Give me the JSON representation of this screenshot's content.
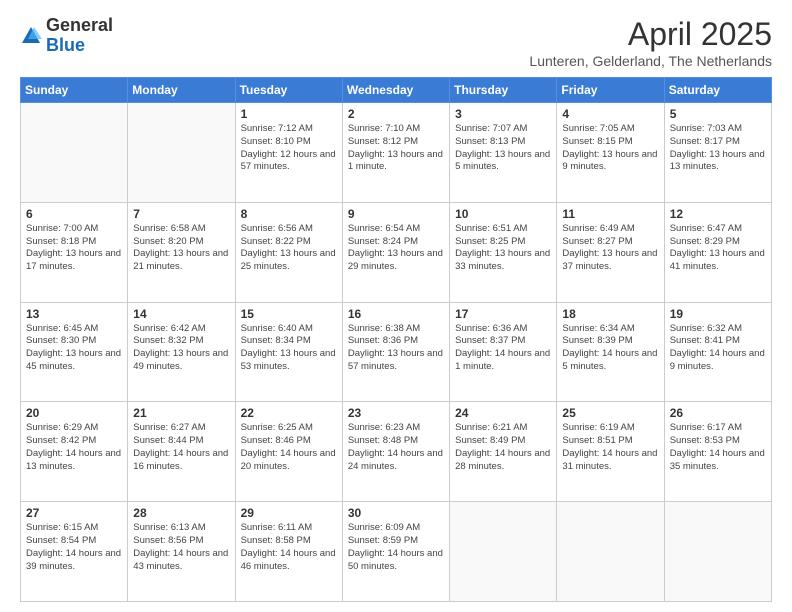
{
  "header": {
    "logo_general": "General",
    "logo_blue": "Blue",
    "month_title": "April 2025",
    "location": "Lunteren, Gelderland, The Netherlands"
  },
  "weekdays": [
    "Sunday",
    "Monday",
    "Tuesday",
    "Wednesday",
    "Thursday",
    "Friday",
    "Saturday"
  ],
  "weeks": [
    [
      {
        "day": "",
        "info": ""
      },
      {
        "day": "",
        "info": ""
      },
      {
        "day": "1",
        "info": "Sunrise: 7:12 AM\nSunset: 8:10 PM\nDaylight: 12 hours and 57 minutes."
      },
      {
        "day": "2",
        "info": "Sunrise: 7:10 AM\nSunset: 8:12 PM\nDaylight: 13 hours and 1 minute."
      },
      {
        "day": "3",
        "info": "Sunrise: 7:07 AM\nSunset: 8:13 PM\nDaylight: 13 hours and 5 minutes."
      },
      {
        "day": "4",
        "info": "Sunrise: 7:05 AM\nSunset: 8:15 PM\nDaylight: 13 hours and 9 minutes."
      },
      {
        "day": "5",
        "info": "Sunrise: 7:03 AM\nSunset: 8:17 PM\nDaylight: 13 hours and 13 minutes."
      }
    ],
    [
      {
        "day": "6",
        "info": "Sunrise: 7:00 AM\nSunset: 8:18 PM\nDaylight: 13 hours and 17 minutes."
      },
      {
        "day": "7",
        "info": "Sunrise: 6:58 AM\nSunset: 8:20 PM\nDaylight: 13 hours and 21 minutes."
      },
      {
        "day": "8",
        "info": "Sunrise: 6:56 AM\nSunset: 8:22 PM\nDaylight: 13 hours and 25 minutes."
      },
      {
        "day": "9",
        "info": "Sunrise: 6:54 AM\nSunset: 8:24 PM\nDaylight: 13 hours and 29 minutes."
      },
      {
        "day": "10",
        "info": "Sunrise: 6:51 AM\nSunset: 8:25 PM\nDaylight: 13 hours and 33 minutes."
      },
      {
        "day": "11",
        "info": "Sunrise: 6:49 AM\nSunset: 8:27 PM\nDaylight: 13 hours and 37 minutes."
      },
      {
        "day": "12",
        "info": "Sunrise: 6:47 AM\nSunset: 8:29 PM\nDaylight: 13 hours and 41 minutes."
      }
    ],
    [
      {
        "day": "13",
        "info": "Sunrise: 6:45 AM\nSunset: 8:30 PM\nDaylight: 13 hours and 45 minutes."
      },
      {
        "day": "14",
        "info": "Sunrise: 6:42 AM\nSunset: 8:32 PM\nDaylight: 13 hours and 49 minutes."
      },
      {
        "day": "15",
        "info": "Sunrise: 6:40 AM\nSunset: 8:34 PM\nDaylight: 13 hours and 53 minutes."
      },
      {
        "day": "16",
        "info": "Sunrise: 6:38 AM\nSunset: 8:36 PM\nDaylight: 13 hours and 57 minutes."
      },
      {
        "day": "17",
        "info": "Sunrise: 6:36 AM\nSunset: 8:37 PM\nDaylight: 14 hours and 1 minute."
      },
      {
        "day": "18",
        "info": "Sunrise: 6:34 AM\nSunset: 8:39 PM\nDaylight: 14 hours and 5 minutes."
      },
      {
        "day": "19",
        "info": "Sunrise: 6:32 AM\nSunset: 8:41 PM\nDaylight: 14 hours and 9 minutes."
      }
    ],
    [
      {
        "day": "20",
        "info": "Sunrise: 6:29 AM\nSunset: 8:42 PM\nDaylight: 14 hours and 13 minutes."
      },
      {
        "day": "21",
        "info": "Sunrise: 6:27 AM\nSunset: 8:44 PM\nDaylight: 14 hours and 16 minutes."
      },
      {
        "day": "22",
        "info": "Sunrise: 6:25 AM\nSunset: 8:46 PM\nDaylight: 14 hours and 20 minutes."
      },
      {
        "day": "23",
        "info": "Sunrise: 6:23 AM\nSunset: 8:48 PM\nDaylight: 14 hours and 24 minutes."
      },
      {
        "day": "24",
        "info": "Sunrise: 6:21 AM\nSunset: 8:49 PM\nDaylight: 14 hours and 28 minutes."
      },
      {
        "day": "25",
        "info": "Sunrise: 6:19 AM\nSunset: 8:51 PM\nDaylight: 14 hours and 31 minutes."
      },
      {
        "day": "26",
        "info": "Sunrise: 6:17 AM\nSunset: 8:53 PM\nDaylight: 14 hours and 35 minutes."
      }
    ],
    [
      {
        "day": "27",
        "info": "Sunrise: 6:15 AM\nSunset: 8:54 PM\nDaylight: 14 hours and 39 minutes."
      },
      {
        "day": "28",
        "info": "Sunrise: 6:13 AM\nSunset: 8:56 PM\nDaylight: 14 hours and 43 minutes."
      },
      {
        "day": "29",
        "info": "Sunrise: 6:11 AM\nSunset: 8:58 PM\nDaylight: 14 hours and 46 minutes."
      },
      {
        "day": "30",
        "info": "Sunrise: 6:09 AM\nSunset: 8:59 PM\nDaylight: 14 hours and 50 minutes."
      },
      {
        "day": "",
        "info": ""
      },
      {
        "day": "",
        "info": ""
      },
      {
        "day": "",
        "info": ""
      }
    ]
  ]
}
